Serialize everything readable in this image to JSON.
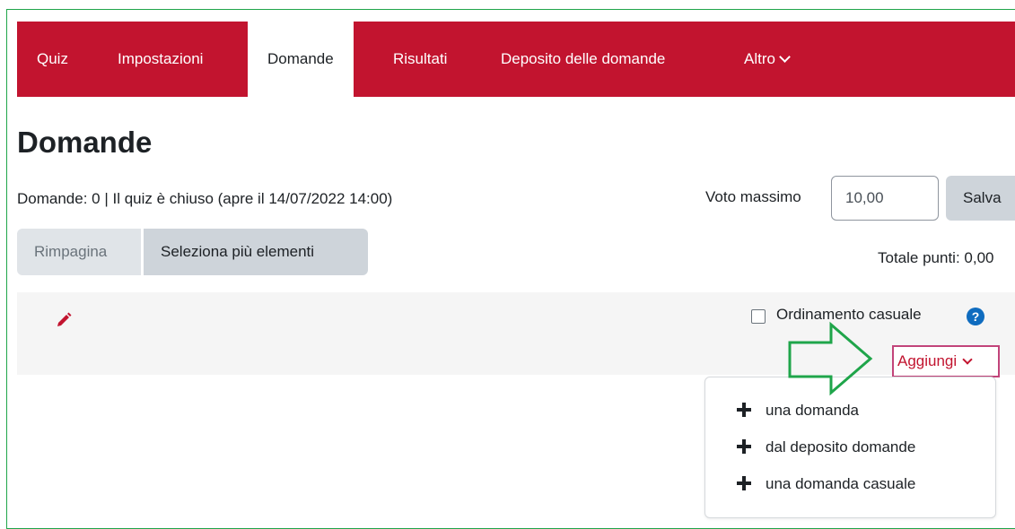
{
  "nav": {
    "items": [
      {
        "label": "Quiz"
      },
      {
        "label": "Impostazioni"
      },
      {
        "label": "Domande",
        "active": true
      },
      {
        "label": "Risultati"
      },
      {
        "label": "Deposito delle domande"
      },
      {
        "label": "Altro"
      }
    ]
  },
  "page": {
    "title": "Domande",
    "status": "Domande: 0 | Il quiz è chiuso (apre il 14/07/2022 14:00)",
    "max_grade_label": "Voto massimo",
    "max_grade_value": "10,00",
    "save_label": "Salva",
    "repaginate_label": "Rimpagina",
    "select_multiple_label": "Seleziona più elementi",
    "total_points": "Totale punti: 0,00"
  },
  "section": {
    "shuffle_label": "Ordinamento casuale",
    "help_glyph": "?",
    "add_label": "Aggiungi"
  },
  "add_menu": {
    "items": [
      {
        "label": "una domanda"
      },
      {
        "label": "dal deposito domande"
      },
      {
        "label": "una domanda casuale"
      }
    ]
  },
  "colors": {
    "brand": "#c2142f",
    "annotation_arrow": "#1fa54a",
    "help_icon": "#0f6cbf"
  },
  "icons": {
    "edit": "pencil-icon",
    "add": "plus-icon",
    "help": "question-circle-icon",
    "dropdown": "chevron-down-icon"
  }
}
